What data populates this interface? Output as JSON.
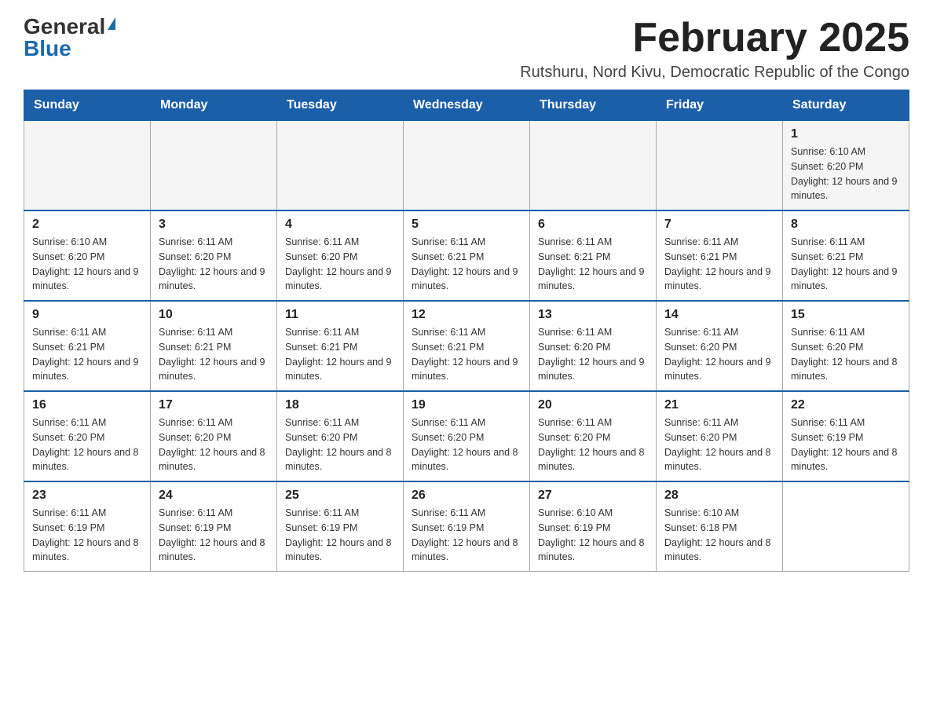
{
  "logo": {
    "general": "General",
    "blue": "Blue"
  },
  "title": "February 2025",
  "location": "Rutshuru, Nord Kivu, Democratic Republic of the Congo",
  "weekdays": [
    "Sunday",
    "Monday",
    "Tuesday",
    "Wednesday",
    "Thursday",
    "Friday",
    "Saturday"
  ],
  "weeks": [
    [
      {
        "day": "",
        "info": ""
      },
      {
        "day": "",
        "info": ""
      },
      {
        "day": "",
        "info": ""
      },
      {
        "day": "",
        "info": ""
      },
      {
        "day": "",
        "info": ""
      },
      {
        "day": "",
        "info": ""
      },
      {
        "day": "1",
        "info": "Sunrise: 6:10 AM\nSunset: 6:20 PM\nDaylight: 12 hours and 9 minutes."
      }
    ],
    [
      {
        "day": "2",
        "info": "Sunrise: 6:10 AM\nSunset: 6:20 PM\nDaylight: 12 hours and 9 minutes."
      },
      {
        "day": "3",
        "info": "Sunrise: 6:11 AM\nSunset: 6:20 PM\nDaylight: 12 hours and 9 minutes."
      },
      {
        "day": "4",
        "info": "Sunrise: 6:11 AM\nSunset: 6:20 PM\nDaylight: 12 hours and 9 minutes."
      },
      {
        "day": "5",
        "info": "Sunrise: 6:11 AM\nSunset: 6:21 PM\nDaylight: 12 hours and 9 minutes."
      },
      {
        "day": "6",
        "info": "Sunrise: 6:11 AM\nSunset: 6:21 PM\nDaylight: 12 hours and 9 minutes."
      },
      {
        "day": "7",
        "info": "Sunrise: 6:11 AM\nSunset: 6:21 PM\nDaylight: 12 hours and 9 minutes."
      },
      {
        "day": "8",
        "info": "Sunrise: 6:11 AM\nSunset: 6:21 PM\nDaylight: 12 hours and 9 minutes."
      }
    ],
    [
      {
        "day": "9",
        "info": "Sunrise: 6:11 AM\nSunset: 6:21 PM\nDaylight: 12 hours and 9 minutes."
      },
      {
        "day": "10",
        "info": "Sunrise: 6:11 AM\nSunset: 6:21 PM\nDaylight: 12 hours and 9 minutes."
      },
      {
        "day": "11",
        "info": "Sunrise: 6:11 AM\nSunset: 6:21 PM\nDaylight: 12 hours and 9 minutes."
      },
      {
        "day": "12",
        "info": "Sunrise: 6:11 AM\nSunset: 6:21 PM\nDaylight: 12 hours and 9 minutes."
      },
      {
        "day": "13",
        "info": "Sunrise: 6:11 AM\nSunset: 6:20 PM\nDaylight: 12 hours and 9 minutes."
      },
      {
        "day": "14",
        "info": "Sunrise: 6:11 AM\nSunset: 6:20 PM\nDaylight: 12 hours and 9 minutes."
      },
      {
        "day": "15",
        "info": "Sunrise: 6:11 AM\nSunset: 6:20 PM\nDaylight: 12 hours and 8 minutes."
      }
    ],
    [
      {
        "day": "16",
        "info": "Sunrise: 6:11 AM\nSunset: 6:20 PM\nDaylight: 12 hours and 8 minutes."
      },
      {
        "day": "17",
        "info": "Sunrise: 6:11 AM\nSunset: 6:20 PM\nDaylight: 12 hours and 8 minutes."
      },
      {
        "day": "18",
        "info": "Sunrise: 6:11 AM\nSunset: 6:20 PM\nDaylight: 12 hours and 8 minutes."
      },
      {
        "day": "19",
        "info": "Sunrise: 6:11 AM\nSunset: 6:20 PM\nDaylight: 12 hours and 8 minutes."
      },
      {
        "day": "20",
        "info": "Sunrise: 6:11 AM\nSunset: 6:20 PM\nDaylight: 12 hours and 8 minutes."
      },
      {
        "day": "21",
        "info": "Sunrise: 6:11 AM\nSunset: 6:20 PM\nDaylight: 12 hours and 8 minutes."
      },
      {
        "day": "22",
        "info": "Sunrise: 6:11 AM\nSunset: 6:19 PM\nDaylight: 12 hours and 8 minutes."
      }
    ],
    [
      {
        "day": "23",
        "info": "Sunrise: 6:11 AM\nSunset: 6:19 PM\nDaylight: 12 hours and 8 minutes."
      },
      {
        "day": "24",
        "info": "Sunrise: 6:11 AM\nSunset: 6:19 PM\nDaylight: 12 hours and 8 minutes."
      },
      {
        "day": "25",
        "info": "Sunrise: 6:11 AM\nSunset: 6:19 PM\nDaylight: 12 hours and 8 minutes."
      },
      {
        "day": "26",
        "info": "Sunrise: 6:11 AM\nSunset: 6:19 PM\nDaylight: 12 hours and 8 minutes."
      },
      {
        "day": "27",
        "info": "Sunrise: 6:10 AM\nSunset: 6:19 PM\nDaylight: 12 hours and 8 minutes."
      },
      {
        "day": "28",
        "info": "Sunrise: 6:10 AM\nSunset: 6:18 PM\nDaylight: 12 hours and 8 minutes."
      },
      {
        "day": "",
        "info": ""
      }
    ]
  ]
}
